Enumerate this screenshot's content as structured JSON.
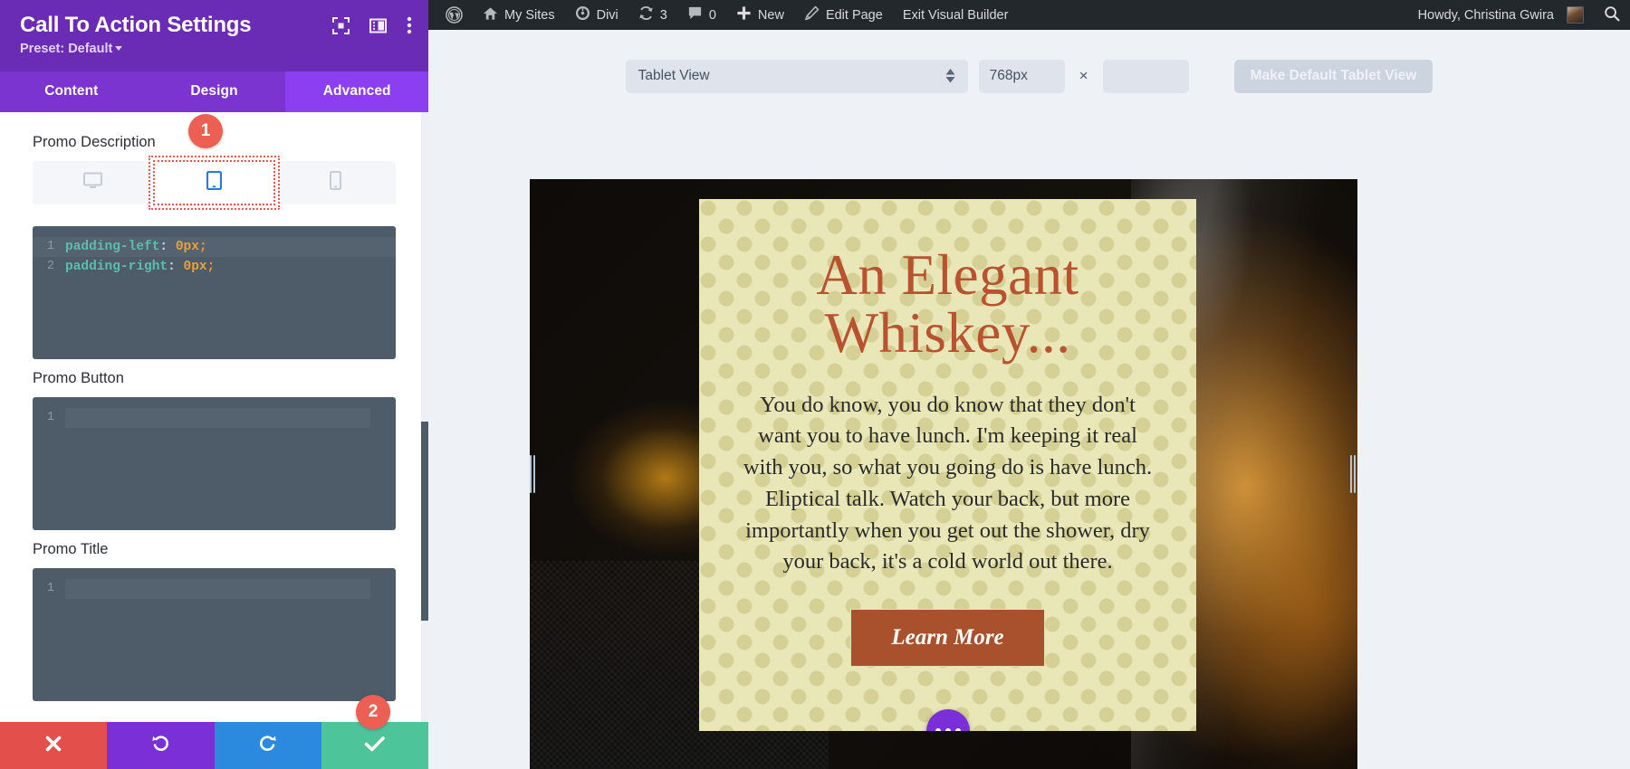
{
  "panel": {
    "title": "Call To Action Settings",
    "preset_label": "Preset: Default",
    "header_icons": [
      {
        "name": "focus-target-icon"
      },
      {
        "name": "layout-columns-icon"
      },
      {
        "name": "kebab-menu-icon"
      }
    ],
    "tabs": [
      {
        "label": "Content",
        "active": false
      },
      {
        "label": "Design",
        "active": false
      },
      {
        "label": "Advanced",
        "active": true
      }
    ],
    "sections": [
      {
        "label": "Promo Description",
        "devices": [
          {
            "name": "desktop-icon",
            "active": false
          },
          {
            "name": "tablet-icon",
            "active": true
          },
          {
            "name": "phone-icon",
            "active": false
          }
        ],
        "code_lines": [
          {
            "number": "1",
            "property": "padding-left",
            "colon": ": ",
            "value": "0px",
            "semi": ";"
          },
          {
            "number": "2",
            "property": "padding-right",
            "colon": ": ",
            "value": "0px",
            "semi": ";"
          }
        ]
      },
      {
        "label": "Promo Button",
        "code_lines": [
          {
            "number": "1",
            "property": "",
            "colon": "",
            "value": "",
            "semi": ""
          }
        ]
      },
      {
        "label": "Promo Title",
        "code_lines": [
          {
            "number": "1",
            "property": "",
            "colon": "",
            "value": "",
            "semi": ""
          }
        ]
      }
    ],
    "actions": [
      {
        "name": "cancel-button",
        "icon": "close-x-icon",
        "color": "#e34f4a"
      },
      {
        "name": "undo-button",
        "icon": "undo-arrow-icon",
        "color": "#7b2fd6"
      },
      {
        "name": "redo-button",
        "icon": "redo-arrow-icon",
        "color": "#2c8ade"
      },
      {
        "name": "save-button",
        "icon": "checkmark-icon",
        "color": "#4ec49a"
      }
    ],
    "step_badges": [
      {
        "number": "1"
      },
      {
        "number": "2"
      }
    ]
  },
  "admin_bar": {
    "logo": "wordpress-logo-icon",
    "items": [
      {
        "label": "My Sites",
        "icon": "sites-house-icon"
      },
      {
        "label": "Divi",
        "icon": "divi-dashboard-icon"
      },
      {
        "label": "3",
        "icon": "updates-refresh-icon"
      },
      {
        "label": "0",
        "icon": "comments-bubble-icon"
      },
      {
        "label": "New",
        "icon": "plus-icon"
      },
      {
        "label": "Edit Page",
        "icon": "pencil-edit-icon"
      },
      {
        "label": "Exit Visual Builder",
        "icon": ""
      }
    ],
    "greeting": "Howdy, Christina Gwira",
    "avatar": "user-avatar",
    "search": "search-icon"
  },
  "responsive_toolbar": {
    "view_select_value": "Tablet View",
    "width_value": "768px",
    "separator": "×",
    "height_value": "",
    "height_placeholder": "",
    "make_default_label": "Make Default Tablet View"
  },
  "preview": {
    "cta_title": "An Elegant Whiskey...",
    "cta_title_line1": "An Elegant",
    "cta_title_line2": "Whiskey...",
    "cta_body": "You do know, you do know that they don't want you to have lunch. I'm keeping it real with you, so what you going do is have lunch. Eliptical talk. Watch your back, but more importantly when you get out the shower, dry your back, it's a cold world out there.",
    "cta_button_label": "Learn More",
    "module_settings_icon": "ellipsis-dots-icon",
    "drag_handle_left": "resize-handle-left",
    "drag_handle_right": "resize-handle-right"
  },
  "colors": {
    "panel_header": "#6a2cb5",
    "tab_active": "#8b3ff0",
    "tab_bar": "#7b34cf",
    "code_bg": "#4e5b69",
    "accent_badge": "#ed5f52",
    "cta_bg": "#e9e6b8",
    "cta_title": "#b9532f",
    "cta_button": "#a9502c",
    "admin_bar": "#23282d",
    "builder_bg": "#eef1f6"
  }
}
